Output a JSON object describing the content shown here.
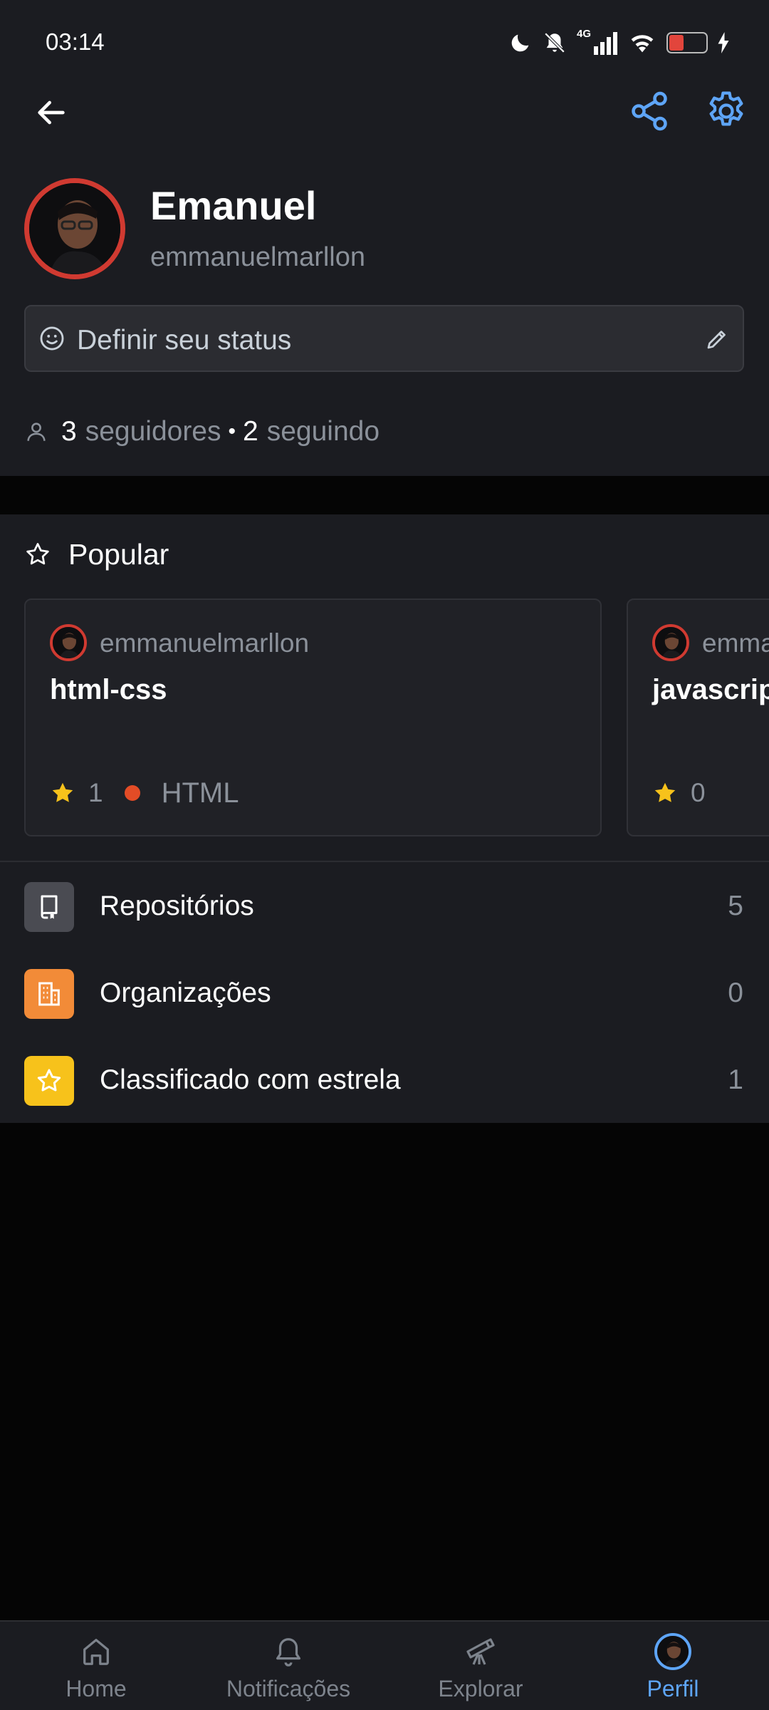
{
  "status_bar": {
    "time": "03:14",
    "network": "4G",
    "battery": "7"
  },
  "header": {
    "back_icon": "arrow-left-icon",
    "share_icon": "share-icon",
    "settings_icon": "gear-icon"
  },
  "profile": {
    "name": "Emanuel",
    "login": "emmanuelmarllon",
    "status_placeholder": "Definir seu status",
    "followers_count": "3",
    "followers_label": "seguidores",
    "following_count": "2",
    "following_label": "seguindo",
    "separator": "•"
  },
  "popular": {
    "title": "Popular",
    "repos": [
      {
        "owner": "emmanuelmarllon",
        "name": "html-css",
        "stars": "1",
        "language": "HTML",
        "language_color": "#e34c26"
      },
      {
        "owner": "emmanuelmarllon",
        "name": "javascript",
        "stars": "0"
      }
    ]
  },
  "menu": [
    {
      "label": "Repositórios",
      "count": "5",
      "icon": "repo-icon",
      "color": "#4a4b52"
    },
    {
      "label": "Organizações",
      "count": "0",
      "icon": "organization-icon",
      "color": "#f28b38"
    },
    {
      "label": "Classificado com estrela",
      "count": "1",
      "icon": "star-icon",
      "color": "#f7c21b"
    }
  ],
  "bottom_nav": [
    {
      "label": "Home",
      "icon": "home-icon"
    },
    {
      "label": "Notificações",
      "icon": "bell-icon"
    },
    {
      "label": "Explorar",
      "icon": "telescope-icon"
    },
    {
      "label": "Perfil",
      "icon": "avatar",
      "active": true
    }
  ],
  "colors": {
    "accent": "#5ea5f7",
    "background": "#1b1c21",
    "avatar_ring": "#d03a31"
  }
}
